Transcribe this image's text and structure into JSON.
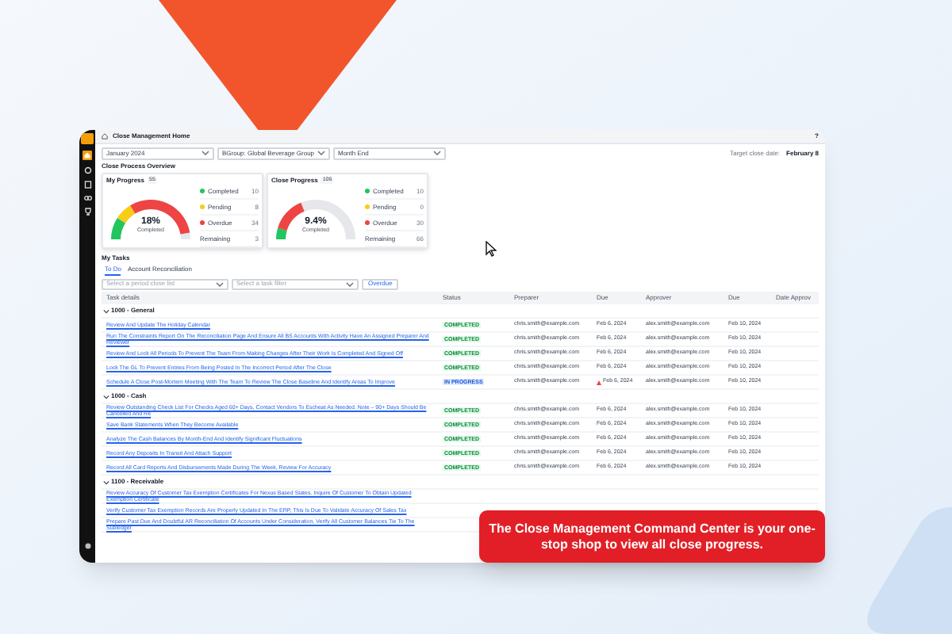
{
  "window": {
    "title": "Close Management Home",
    "help": "?"
  },
  "filters": [
    {
      "value": "January 2024"
    },
    {
      "value": "BGroup: Global Beverage Group"
    },
    {
      "value": "Month End"
    }
  ],
  "target_close": {
    "label": "Target close date:",
    "value": "February 8"
  },
  "overview": {
    "title": "Close Process Overview",
    "cards": [
      {
        "title": "My Progress",
        "badge": "55",
        "percent": "18%",
        "caption": "Completed",
        "legend": [
          {
            "label": "Completed",
            "count": "10",
            "color": "#22c55e"
          },
          {
            "label": "Pending",
            "count": "8",
            "color": "#facc15"
          },
          {
            "label": "Overdue",
            "count": "34",
            "color": "#ef4444"
          },
          {
            "label": "Remaining",
            "count": "3"
          }
        ]
      },
      {
        "title": "Close Progress",
        "badge": "106",
        "percent": "9.4%",
        "caption": "Completed",
        "legend": [
          {
            "label": "Completed",
            "count": "10",
            "color": "#22c55e"
          },
          {
            "label": "Pending",
            "count": "0",
            "color": "#facc15"
          },
          {
            "label": "Overdue",
            "count": "30",
            "color": "#ef4444"
          },
          {
            "label": "Remaining",
            "count": "66"
          }
        ]
      }
    ]
  },
  "tasks": {
    "title": "My Tasks",
    "tabs": [
      {
        "label": "To Do",
        "selected": true
      },
      {
        "label": "Account Reconciliation",
        "selected": false
      }
    ],
    "selects": [
      {
        "placeholder": "Select a period close list"
      },
      {
        "placeholder": "Select a task filter"
      }
    ],
    "button": "Overdue",
    "columns": [
      "Task details",
      "Status",
      "Preparer",
      "Due",
      "Approver",
      "Due",
      "Date Approv"
    ],
    "groups": [
      {
        "name": "1000 - General",
        "expanded": true,
        "rows": [
          {
            "task": "Review And Update The Holiday Calendar",
            "status": "COMPLETED",
            "kind": "completed",
            "overdue": false,
            "preparer": "chris.smith@example.com",
            "due": "Feb 6, 2024",
            "approver": "alex.smith@example.com",
            "due_2": "Feb 10, 2024"
          },
          {
            "task": "Run The Constraints Report On The Reconciliation Page And Ensure All BS Accounts With Activity Have An Assigned Preparer And Reviewer",
            "status": "COMPLETED",
            "kind": "completed",
            "overdue": false,
            "preparer": "chris.smith@example.com",
            "due": "Feb 6, 2024",
            "approver": "alex.smith@example.com",
            "due_2": "Feb 10, 2024"
          },
          {
            "task": "Review And Lock All Periods To Prevent The Team From Making Changes After Their Work Is Completed And Signed Off",
            "status": "COMPLETED",
            "kind": "completed",
            "overdue": false,
            "preparer": "chris.smith@example.com",
            "due": "Feb 6, 2024",
            "approver": "alex.smith@example.com",
            "due_2": "Feb 10, 2024"
          },
          {
            "task": "Lock The GL To Prevent Entries From Being Posted In The Incorrect Period After The Close",
            "status": "COMPLETED",
            "kind": "completed",
            "overdue": false,
            "preparer": "chris.smith@example.com",
            "due": "Feb 6, 2024",
            "approver": "alex.smith@example.com",
            "due_2": "Feb 10, 2024"
          },
          {
            "task": "Schedule A Close Post-Mortem Meeting With The Team To Review The Close Baseline And Identify Areas To Improve",
            "status": "IN PROGRESS",
            "kind": "in_progress",
            "overdue": true,
            "preparer": "chris.smith@example.com",
            "due": "Feb 6, 2024",
            "approver": "alex.smith@example.com",
            "due_2": "Feb 10, 2024"
          }
        ]
      },
      {
        "name": "1000 - Cash",
        "expanded": true,
        "rows": [
          {
            "task": "Review Outstanding Check List For Checks Aged 60+ Days, Contact Vendors To Escheat As Needed. Note – 90+ Days Should Be Cancelled And Re",
            "status": "COMPLETED",
            "kind": "completed",
            "overdue": false,
            "preparer": "chris.smith@example.com",
            "due": "Feb 6, 2024",
            "approver": "alex.smith@example.com",
            "due_2": "Feb 10, 2024"
          },
          {
            "task": "Save Bank Statements When They Become Available",
            "status": "COMPLETED",
            "kind": "completed",
            "overdue": false,
            "preparer": "chris.smith@example.com",
            "due": "Feb 6, 2024",
            "approver": "alex.smith@example.com",
            "due_2": "Feb 10, 2024"
          },
          {
            "task": "Analyze The Cash Balances By Month-End And Identify Significant Fluctuations",
            "status": "COMPLETED",
            "kind": "completed",
            "overdue": false,
            "preparer": "chris.smith@example.com",
            "due": "Feb 6, 2024",
            "approver": "alex.smith@example.com",
            "due_2": "Feb 10, 2024"
          },
          {
            "task": "Record Any Deposits In Transit And Attach Support",
            "status": "COMPLETED",
            "kind": "completed",
            "overdue": false,
            "preparer": "chris.smith@example.com",
            "due": "Feb 6, 2024",
            "approver": "alex.smith@example.com",
            "due_2": "Feb 10, 2024"
          },
          {
            "task": "Record All Card Reports And Disbursements Made During The Week, Review For Accuracy",
            "status": "COMPLETED",
            "kind": "completed",
            "overdue": false,
            "preparer": "chris.smith@example.com",
            "due": "Feb 6, 2024",
            "approver": "alex.smith@example.com",
            "due_2": "Feb 10, 2024"
          }
        ]
      },
      {
        "name": "1100 - Receivable",
        "expanded": true,
        "rows": [
          {
            "task": "Review Accuracy Of Customer Tax Exemption Certificates For Nexus Based States. Inquire Of Customer To Obtain Updated Exemption Certificate"
          },
          {
            "task": "Verify Customer Tax Exemption Records Are Properly Updated In The ERP, This Is Due To Validate Accuracy Of Sales Tax"
          },
          {
            "task": "Prepare Past Due And Doubtful AR Reconciliation Of Accounts Under Consideration, Verify All Customer Balances Tie To The Subledger"
          }
        ]
      }
    ]
  },
  "callout": "The Close Management Command Center is your one-stop shop to view all close progress."
}
